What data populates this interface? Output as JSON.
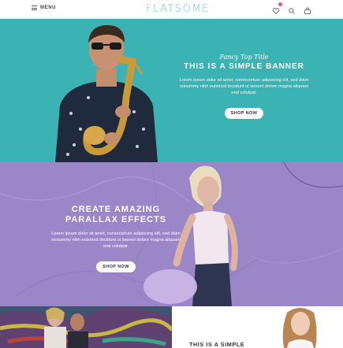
{
  "header": {
    "menu_label": "MENU",
    "logo": "FLATSOME",
    "icons": [
      "heart-icon",
      "search-icon",
      "cart-icon"
    ]
  },
  "banner1": {
    "kicker": "Fancy Top Title",
    "title": "THIS IS A SIMPLE BANNER",
    "body": "Lorem ipsum dolor sit amet, consectetuer adipiscing elit, sed diam nonummy nibh euismod tincidunt ut laoreet dolore magna aliquam erat volutpat.",
    "button": "SHOP NOW",
    "bg_color": "#3bb3b4"
  },
  "banner2": {
    "title": "CREATE AMAZING PARALLAX EFFECTS",
    "body": "Lorem ipsum dolor sit amet, consectetuer adipiscing elit, sed diam nonummy nibh euismod tincidunt ut laoreet dolore magna aliquam erat volutpat.",
    "button": "SHOP NOW",
    "bg_color": "#9b86c8"
  },
  "bottom": {
    "right_title": "THIS IS A SIMPLE"
  }
}
